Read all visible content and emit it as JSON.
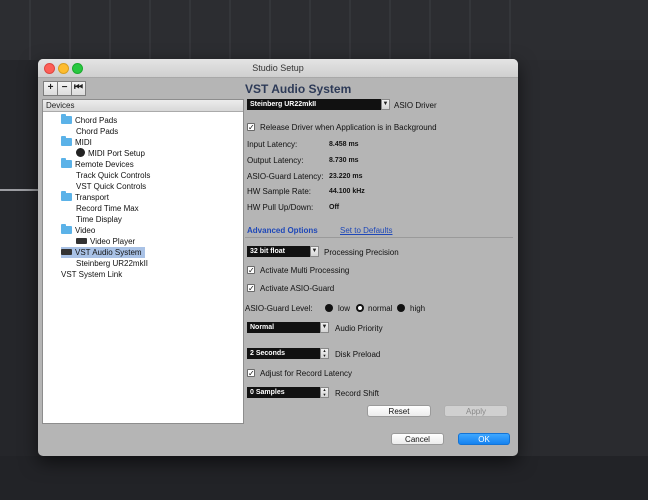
{
  "window": {
    "title": "Studio Setup"
  },
  "toolbar": {
    "add_label": "+",
    "remove_label": "−",
    "reset_label": "⏮"
  },
  "devices": {
    "header": "Devices",
    "items": [
      {
        "label": "Chord Pads",
        "icon": "folder-icon",
        "selected": false
      },
      {
        "label": "Chord Pads",
        "icon": "",
        "selected": false
      },
      {
        "label": "MIDI",
        "icon": "folder-icon",
        "selected": false
      },
      {
        "label": "MIDI Port Setup",
        "icon": "midi-port-icon",
        "selected": false
      },
      {
        "label": "Remote Devices",
        "icon": "folder-icon",
        "selected": false
      },
      {
        "label": "Track Quick Controls",
        "icon": "",
        "selected": false
      },
      {
        "label": "VST Quick Controls",
        "icon": "",
        "selected": false
      },
      {
        "label": "Transport",
        "icon": "folder-icon",
        "selected": false
      },
      {
        "label": "Record Time Max",
        "icon": "",
        "selected": false
      },
      {
        "label": "Time Display",
        "icon": "",
        "selected": false
      },
      {
        "label": "Video",
        "icon": "folder-icon",
        "selected": false
      },
      {
        "label": "Video Player",
        "icon": "video-player-icon",
        "selected": false
      },
      {
        "label": "VST Audio System",
        "icon": "vst-audio-icon",
        "selected": true
      },
      {
        "label": "Steinberg UR22mkII",
        "icon": "",
        "selected": false
      },
      {
        "label": "VST System Link",
        "icon": "",
        "selected": false
      }
    ]
  },
  "panel": {
    "title": "VST Audio System",
    "asio_driver": {
      "value": "Steinberg UR22mkII",
      "label": "ASIO Driver"
    },
    "release_driver": {
      "label": "Release Driver when Application is in Background",
      "checked": true
    },
    "info": [
      {
        "label": "Input Latency:",
        "value": "8.458 ms"
      },
      {
        "label": "Output Latency:",
        "value": "8.730 ms"
      },
      {
        "label": "ASIO-Guard Latency:",
        "value": "23.220 ms"
      },
      {
        "label": "HW Sample Rate:",
        "value": "44.100 kHz"
      },
      {
        "label": "HW Pull Up/Down:",
        "value": "Off"
      }
    ],
    "tab_advanced": "Advanced Options",
    "set_defaults": "Set to Defaults",
    "precision": {
      "value": "32 bit float",
      "label": "Processing Precision"
    },
    "multi_processing": {
      "label": "Activate Multi Processing",
      "checked": true
    },
    "asio_guard": {
      "label": "Activate ASIO-Guard",
      "checked": true
    },
    "guard_level": {
      "label": "ASIO-Guard Level:",
      "options": [
        "low",
        "normal",
        "high"
      ],
      "selected": "normal"
    },
    "audio_priority": {
      "value": "Normal",
      "label": "Audio Priority"
    },
    "disk_preload": {
      "value": "2 Seconds",
      "label": "Disk Preload"
    },
    "adjust_latency": {
      "label": "Adjust for Record Latency",
      "checked": true
    },
    "record_shift": {
      "value": "0 Samples",
      "label": "Record Shift"
    },
    "reset_label": "Reset",
    "apply_label": "Apply"
  },
  "footer": {
    "cancel_label": "Cancel",
    "ok_label": "OK"
  },
  "colors": {
    "accent": "#1582f0",
    "heading": "#2d3a57",
    "selection": "#a9c2e6",
    "folder": "#5bb2e8"
  }
}
